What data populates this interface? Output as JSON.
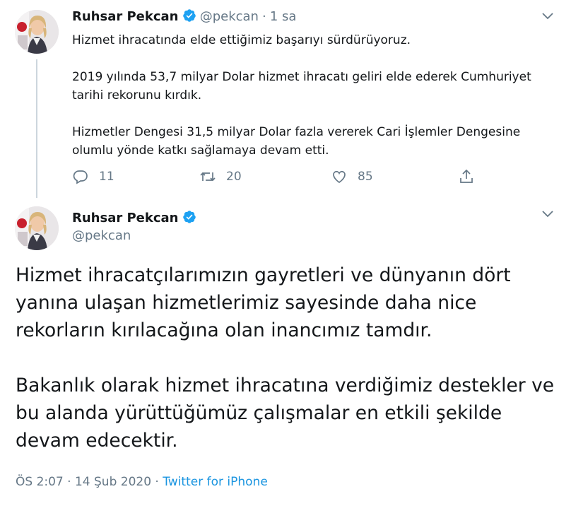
{
  "tweet1": {
    "author_name": "Ruhsar Pekcan",
    "handle": "@pekcan",
    "separator": "·",
    "time": "1 sa",
    "paragraphs": [
      "Hizmet ihracatında elde ettiğimiz başarıyı sürdürüyoruz.",
      "2019 yılında 53,7 milyar Dolar hizmet ihracatı geliri elde ederek Cumhuriyet tarihi rekorunu kırdık.",
      "Hizmetler Dengesi 31,5 milyar Dolar fazla vererek Cari İşlemler Dengesine olumlu yönde katkı sağlamaya devam etti."
    ],
    "reply_count": "11",
    "retweet_count": "20",
    "like_count": "85",
    "icons": [
      "reply-icon",
      "retweet-icon",
      "like-icon",
      "share-icon",
      "chevron-down-icon",
      "verified-badge-icon"
    ]
  },
  "tweet2": {
    "author_name": "Ruhsar Pekcan",
    "handle": "@pekcan",
    "paragraphs": [
      "Hizmet ihracatçılarımızın gayretleri ve dünyanın dört yanına ulaşan hizmetlerimiz sayesinde daha nice rekorların kırılacağına olan inancımız tamdır.",
      "Bakanlık olarak hizmet ihracatına verdiğimiz destekler ve bu alanda yürüttüğümüz çalışmalar en etkili şekilde devam edecektir."
    ],
    "timestamp": "ÖS 2:07 · 14 Şub 2020 · ",
    "source": "Twitter for iPhone"
  },
  "colors": {
    "text": "#14171a",
    "muted": "#657786",
    "accent": "#1b95e0",
    "verified": "#1da1f2",
    "thread_line": "#ccd6dd"
  }
}
